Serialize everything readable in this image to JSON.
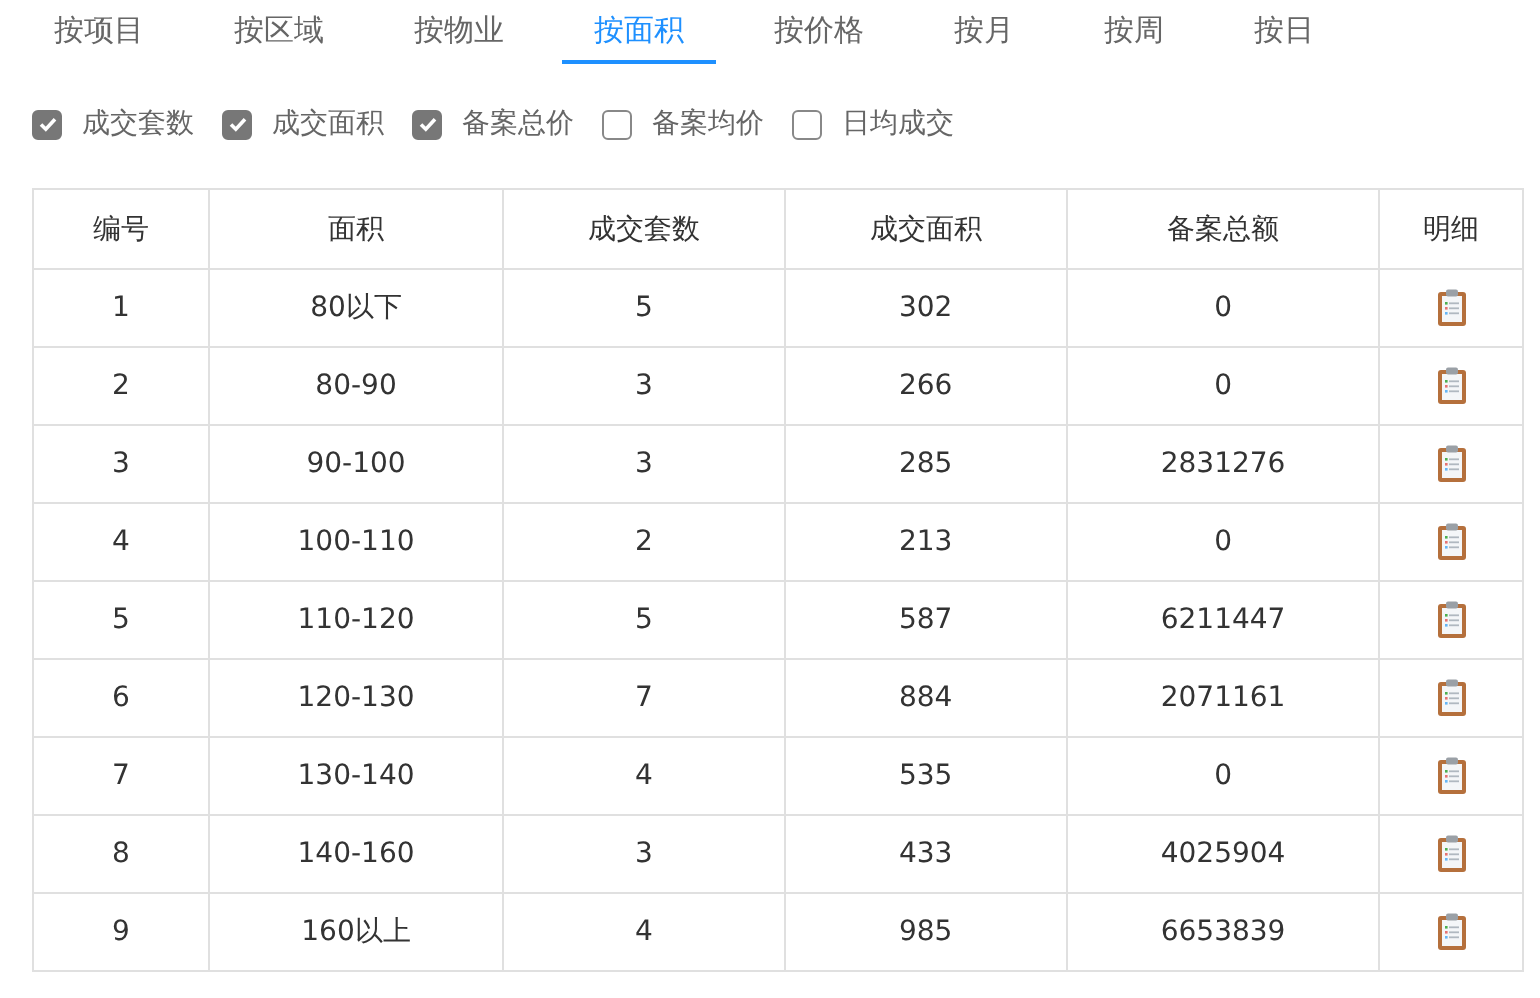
{
  "tabs": [
    {
      "label": "按项目",
      "selected": false
    },
    {
      "label": "按区域",
      "selected": false
    },
    {
      "label": "按物业",
      "selected": false
    },
    {
      "label": "按面积",
      "selected": true
    },
    {
      "label": "按价格",
      "selected": false
    },
    {
      "label": "按月",
      "selected": false
    },
    {
      "label": "按周",
      "selected": false
    },
    {
      "label": "按日",
      "selected": false
    }
  ],
  "options": [
    {
      "label": "成交套数",
      "checked": true
    },
    {
      "label": "成交面积",
      "checked": true
    },
    {
      "label": "备案总价",
      "checked": true
    },
    {
      "label": "备案均价",
      "checked": false
    },
    {
      "label": "日均成交",
      "checked": false
    }
  ],
  "table": {
    "columns": [
      "编号",
      "面积",
      "成交套数",
      "成交面积",
      "备案总额",
      "明细"
    ],
    "rows": [
      [
        "1",
        "80以下",
        "5",
        "302",
        "0"
      ],
      [
        "2",
        "80-90",
        "3",
        "266",
        "0"
      ],
      [
        "3",
        "90-100",
        "3",
        "285",
        "2831276"
      ],
      [
        "4",
        "100-110",
        "2",
        "213",
        "0"
      ],
      [
        "5",
        "110-120",
        "5",
        "587",
        "6211447"
      ],
      [
        "6",
        "120-130",
        "7",
        "884",
        "2071161"
      ],
      [
        "7",
        "130-140",
        "4",
        "535",
        "0"
      ],
      [
        "8",
        "140-160",
        "3",
        "433",
        "4025904"
      ],
      [
        "9",
        "160以上",
        "4",
        "985",
        "6653839"
      ]
    ]
  }
}
